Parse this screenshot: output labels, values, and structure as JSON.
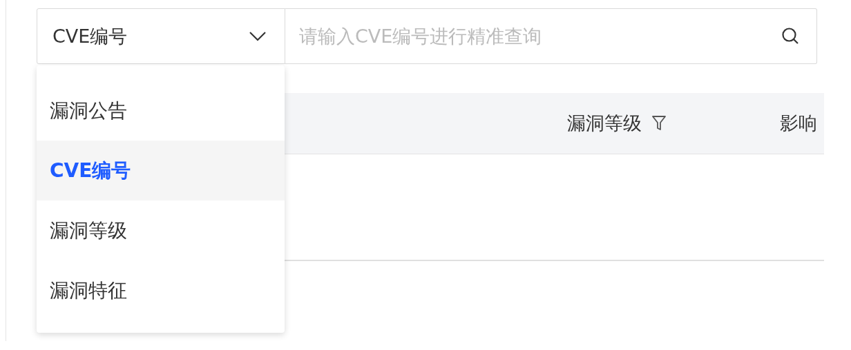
{
  "search": {
    "type_select": {
      "value": "CVE编号",
      "expanded": true
    },
    "placeholder": "请输入CVE编号进行精准查询"
  },
  "dropdown": {
    "options": [
      {
        "label": "漏洞公告",
        "selected": false
      },
      {
        "label": "CVE编号",
        "selected": true
      },
      {
        "label": "漏洞等级",
        "selected": false
      },
      {
        "label": "漏洞特征",
        "selected": false
      }
    ]
  },
  "table": {
    "columns": [
      {
        "label": "漏洞等级",
        "filter": true
      },
      {
        "label": "影响",
        "filter": false
      }
    ]
  }
}
